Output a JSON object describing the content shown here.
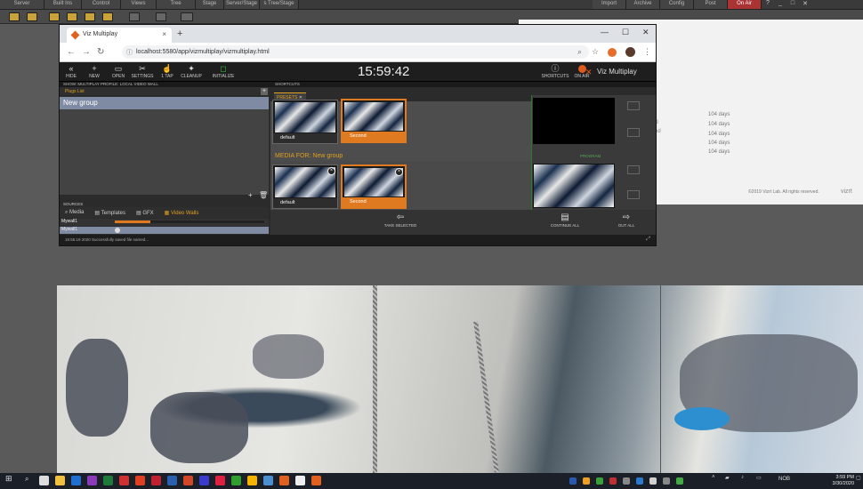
{
  "viz_topbar": {
    "tabs": [
      "Server",
      "Built Ins",
      "Control",
      "Views",
      "Tree",
      "Stage",
      "Server/Stage",
      "s Tree/Stage"
    ],
    "right_tabs": [
      "Import",
      "Archive",
      "Config",
      "Post",
      "On Air"
    ],
    "window_controls": [
      "?",
      "_",
      "□",
      "✕"
    ]
  },
  "white_panel": {
    "days": [
      "104 days",
      "104 days",
      "104 days",
      "104 days",
      "104 days"
    ],
    "cut_labels": [
      "ed",
      "ked"
    ],
    "copyright": "©2019 Vizrt Lab. All rights reserved.",
    "logo": "vizrt"
  },
  "browser": {
    "tab_title": "Viz Multiplay",
    "new_tab": "+",
    "window_controls": [
      "—",
      "☐",
      "✕"
    ],
    "url": "localhost:5580/app/vizmultiplay/vizmultiplay.html"
  },
  "app": {
    "header_buttons": [
      {
        "icon": "«",
        "label": "HIDE"
      },
      {
        "icon": "+",
        "label": "NEW"
      },
      {
        "icon": "▭",
        "label": "OPEN"
      },
      {
        "icon": "✂",
        "label": "SETTINGS"
      },
      {
        "icon": "☝",
        "label": "1 TAP"
      },
      {
        "icon": "✦",
        "label": "CLEANUP"
      },
      {
        "icon": "◻",
        "label": "INITIALIZE"
      }
    ],
    "clock": "15:59:42",
    "shortcuts_label": "SHORTCUTS",
    "on_air_label": "ON AIR",
    "brand": "Viz Multiplay",
    "show_line": "SHOW: MULTIPLAY PROFILE: LOCAL VIDEO WALL",
    "shortcuts_section": "SHORTCUTS",
    "playlist_title": "Plugs List",
    "group_name": "New group",
    "presets_tab": "PRESETS",
    "presets": [
      {
        "label": "default",
        "selected": false
      },
      {
        "label": "Second",
        "selected": true
      }
    ],
    "media_for_label": "MEDIA FOR: New group",
    "group_items": [
      {
        "label": "default",
        "selected": false
      },
      {
        "label": "Second",
        "selected": true
      }
    ],
    "program_label": "PROGRAM",
    "actions": [
      {
        "label": "TAKE SELECTED"
      },
      {
        "label": "CONTINUE ALL"
      },
      {
        "label": "OUT ALL"
      }
    ],
    "sources_title": "SOURCES",
    "source_tabs": [
      "Media",
      "Templates",
      "GFX",
      "Video Walls"
    ],
    "active_source_tab": "Video Walls",
    "source_rows": [
      "Mywall1",
      "Mywall1"
    ],
    "footer_status": "15:55:19 2020   Successfully saved file named..."
  },
  "taskbar": {
    "clock_time": "3:59 PM",
    "clock_date": "3/30/2020",
    "lang": "NOB"
  }
}
